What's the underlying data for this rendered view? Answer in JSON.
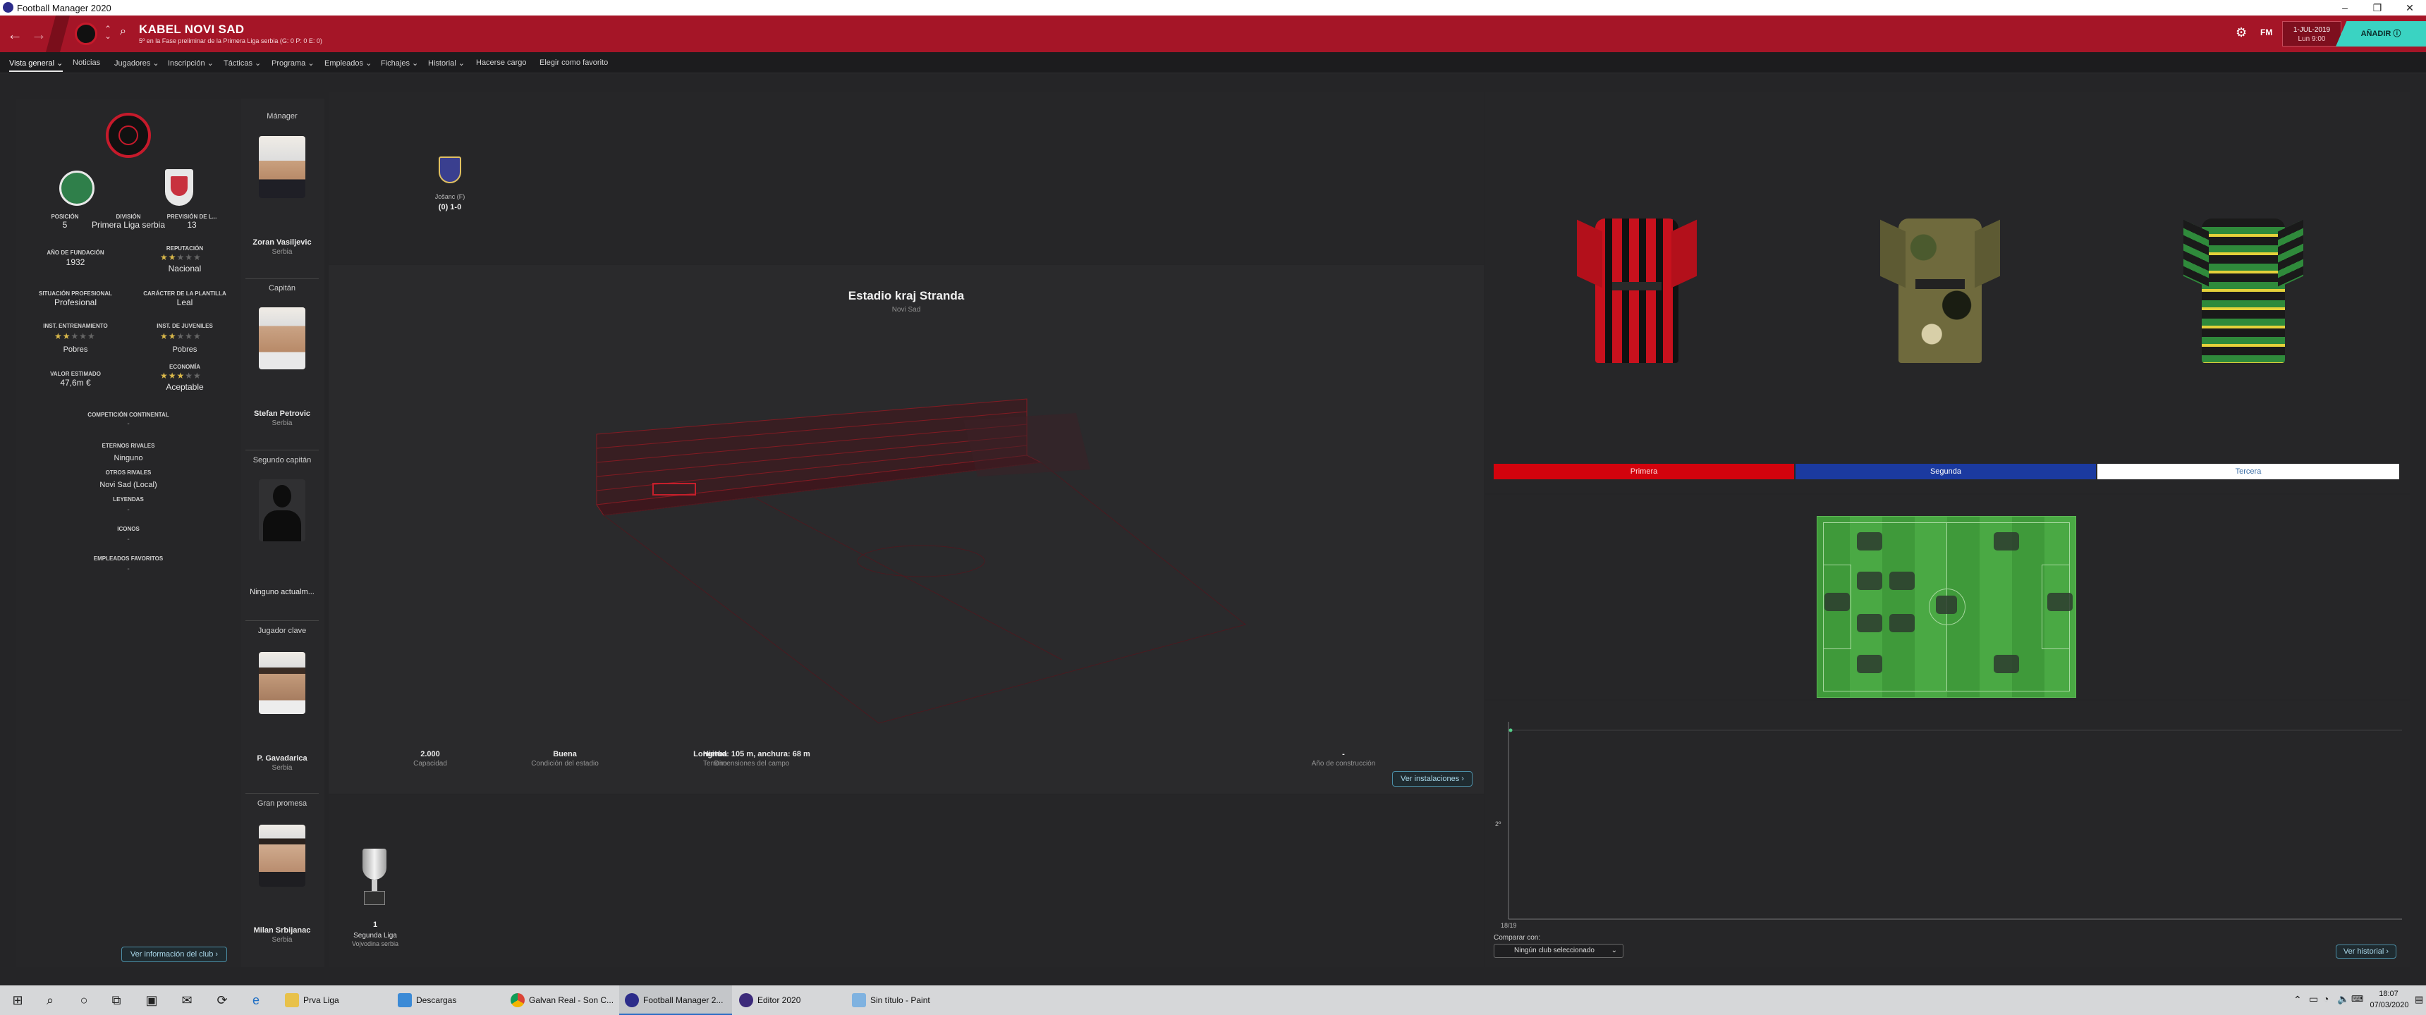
{
  "window": {
    "title": "Football Manager 2020"
  },
  "header": {
    "club_name": "KABEL NOVI SAD",
    "club_subtitle": "5º en la Fase preliminar de la Primera Liga serbia (G: 0 P: 0 E: 0)",
    "fm_label": "FM",
    "date_line1": "1-JUL-2019",
    "date_line2": "Lun 9:00",
    "continue_label": "AÑADIR"
  },
  "tabs": [
    {
      "label": "Vista general ⌄"
    },
    {
      "label": "Noticias"
    },
    {
      "label": "Jugadores ⌄"
    },
    {
      "label": "Inscripción ⌄"
    },
    {
      "label": "Tácticas ⌄"
    },
    {
      "label": "Programa ⌄"
    },
    {
      "label": "Empleados ⌄"
    },
    {
      "label": "Fichajes ⌄"
    },
    {
      "label": "Historial ⌄"
    },
    {
      "label": "Hacerse cargo"
    },
    {
      "label": "Elegir como favorito"
    }
  ],
  "club_info": {
    "position_label": "POSICIÓN",
    "position_value": "5",
    "division_label": "DIVISIÓN",
    "division_value": "Primera Liga serbia",
    "forecast_label": "PREVISIÓN DE L...",
    "forecast_value": "13",
    "founded_label": "AÑO DE FUNDACIÓN",
    "founded_value": "1932",
    "reputation_label": "REPUTACIÓN",
    "reputation_value": "Nacional",
    "reputation_stars": 2,
    "professional_label": "SITUACIÓN PROFESIONAL",
    "professional_value": "Profesional",
    "squad_label": "CARÁCTER DE LA PLANTILLA",
    "squad_value": "Leal",
    "training_label": "INST. ENTRENAMIENTO",
    "training_value": "Pobres",
    "training_stars": 2,
    "youth_label": "INST. DE JUVENILES",
    "youth_value": "Pobres",
    "youth_stars": 2,
    "value_label": "VALOR ESTIMADO",
    "value_value": "47,6m €",
    "economy_label": "ECONOMÍA",
    "economy_value": "Aceptable",
    "economy_stars": 3,
    "continental_label": "COMPETICIÓN CONTINENTAL",
    "continental_value": "-",
    "rivals_label": "ETERNOS RIVALES",
    "rivals_value": "Ninguno",
    "other_rivals_label": "OTROS RIVALES",
    "other_rivals_value": "Novi Sad (Local)",
    "legends_label": "LEYENDAS",
    "legends_value": "-",
    "icons_label": "ICONOS",
    "icons_value": "-",
    "fav_staff_label": "EMPLEADOS FAVORITOS",
    "fav_staff_value": "-",
    "more_info_button": "Ver información del club"
  },
  "people": [
    {
      "role": "Mánager",
      "name": "Zoran Vasiljevic",
      "nationality": "Serbia"
    },
    {
      "role": "Capitán",
      "name": "Stefan Petrovic",
      "nationality": "Serbia"
    },
    {
      "role": "Segundo capitán",
      "name": "Ninguno actualm...",
      "nationality": ""
    },
    {
      "role": "Jugador clave",
      "name": "P. Gavadarica",
      "nationality": "Serbia"
    },
    {
      "role": "Gran promesa",
      "name": "Milan Srbijanac",
      "nationality": "Serbia"
    }
  ],
  "last_match": {
    "team": "Jošanc (F)",
    "score": "(0) 1-0"
  },
  "stadium": {
    "name": "Estadio kraj Stranda",
    "city": "Novi Sad",
    "capacity_value": "2.000",
    "capacity_label": "Capacidad",
    "surface_value": "Hierba",
    "surface_label": "Terreno",
    "condition_value": "Buena",
    "condition_label": "Condición del estadio",
    "dimensions_value": "Longitud: 105 m, anchura: 68 m",
    "dimensions_label": "Dimensiones del campo",
    "built_value": "-",
    "built_label": "Año de construcción",
    "facilities_button": "Ver instalaciones"
  },
  "trophy": {
    "count": "1",
    "competition": "Segunda Liga",
    "subtitle": "Vojvodina serbia"
  },
  "kits": [
    {
      "label": "Primera",
      "color": "#d3030d"
    },
    {
      "label": "Segunda",
      "color": "#1b3aa0"
    },
    {
      "label": "Tercera",
      "color": "#ffffff"
    }
  ],
  "history_chart": {
    "y_label": "2º",
    "x_label": "18/19",
    "compare_label": "Comparar con:",
    "compare_value": "Ningún club seleccionado",
    "history_button": "Ver historial"
  },
  "taskbar": {
    "apps": [
      "Prva Liga",
      "Descargas",
      "Galvan Real - Son C...",
      "Football Manager 2...",
      "Editor 2020",
      "Sin título - Paint"
    ],
    "time": "18:07",
    "date": "07/03/2020"
  }
}
